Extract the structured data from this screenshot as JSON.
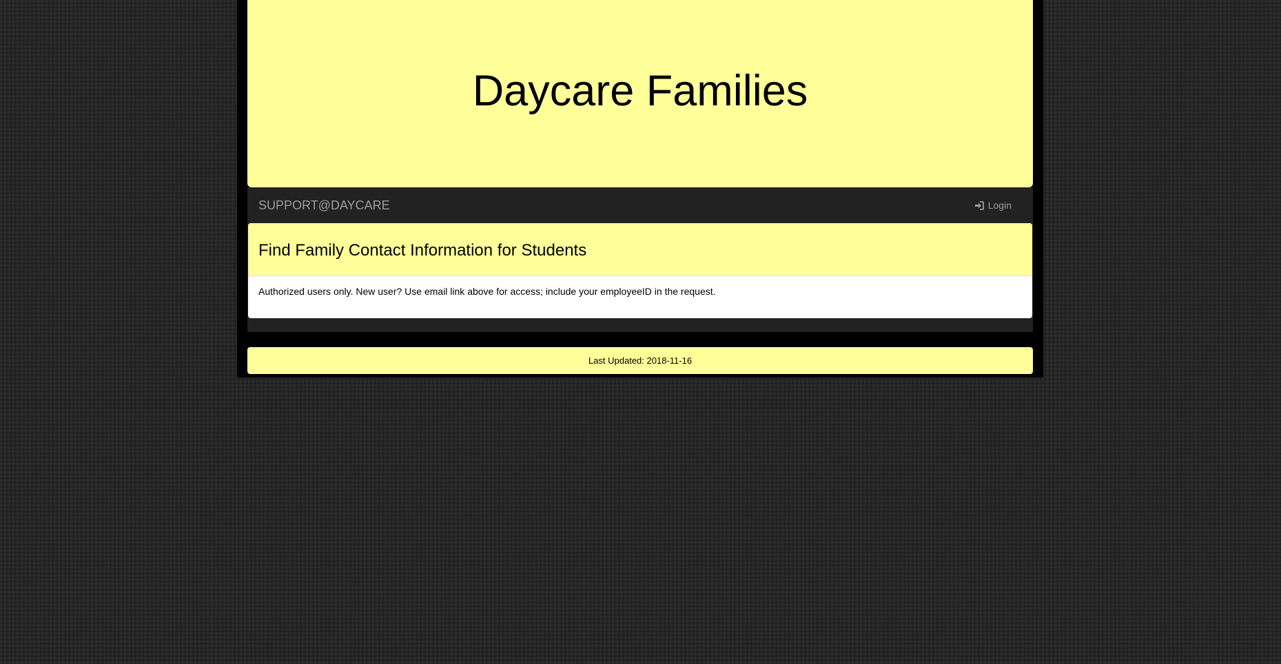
{
  "header": {
    "site_title": "Daycare Families"
  },
  "navbar": {
    "brand": "SUPPORT@DAYCARE",
    "login_label": "Login",
    "login_icon": "log-in-icon"
  },
  "panel": {
    "title": "Find Family Contact Information for Students",
    "body": "Authorized users only. New user? Use email link above for access; include your employeeID in the request."
  },
  "footer": {
    "last_updated": "Last Updated: 2018-11-16"
  },
  "colors": {
    "accent_yellow": "#ffff99",
    "navbar_bg": "#222222",
    "navbar_text": "#9d9d9d",
    "frame_bg": "#000000",
    "page_bg": "#262626"
  }
}
